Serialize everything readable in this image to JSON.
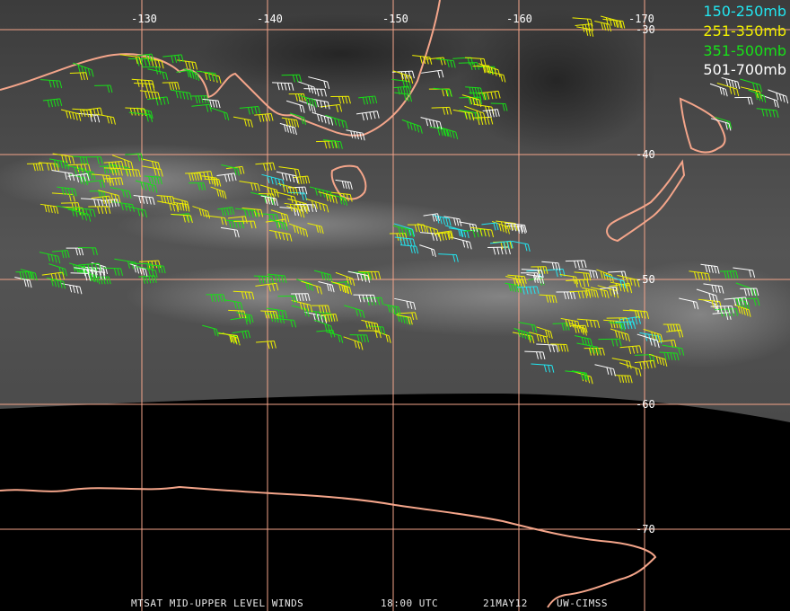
{
  "colors": {
    "coast": "#f4a58a",
    "grid": "#f4a58a",
    "band_150_250": "#22e6f0",
    "band_251_350": "#f0f000",
    "band_351_500": "#18e018",
    "band_501_700": "#ffffff"
  },
  "longitude_labels": [
    "-130",
    "-140",
    "-150",
    "-160",
    "-170"
  ],
  "latitude_labels": [
    "-30",
    "-40",
    "-50",
    "-60",
    "-70"
  ],
  "legend": [
    {
      "label": "150-250mb",
      "color": "#22e6f0"
    },
    {
      "label": "251-350mb",
      "color": "#f0f000"
    },
    {
      "label": "351-500mb",
      "color": "#18e018"
    },
    {
      "label": "501-700mb",
      "color": "#ffffff"
    }
  ],
  "footer": {
    "product": "MTSAT MID-UPPER LEVEL WINDS",
    "time": "18:00 UTC",
    "date": "21MAY12",
    "source": "UW-CIMSS"
  }
}
